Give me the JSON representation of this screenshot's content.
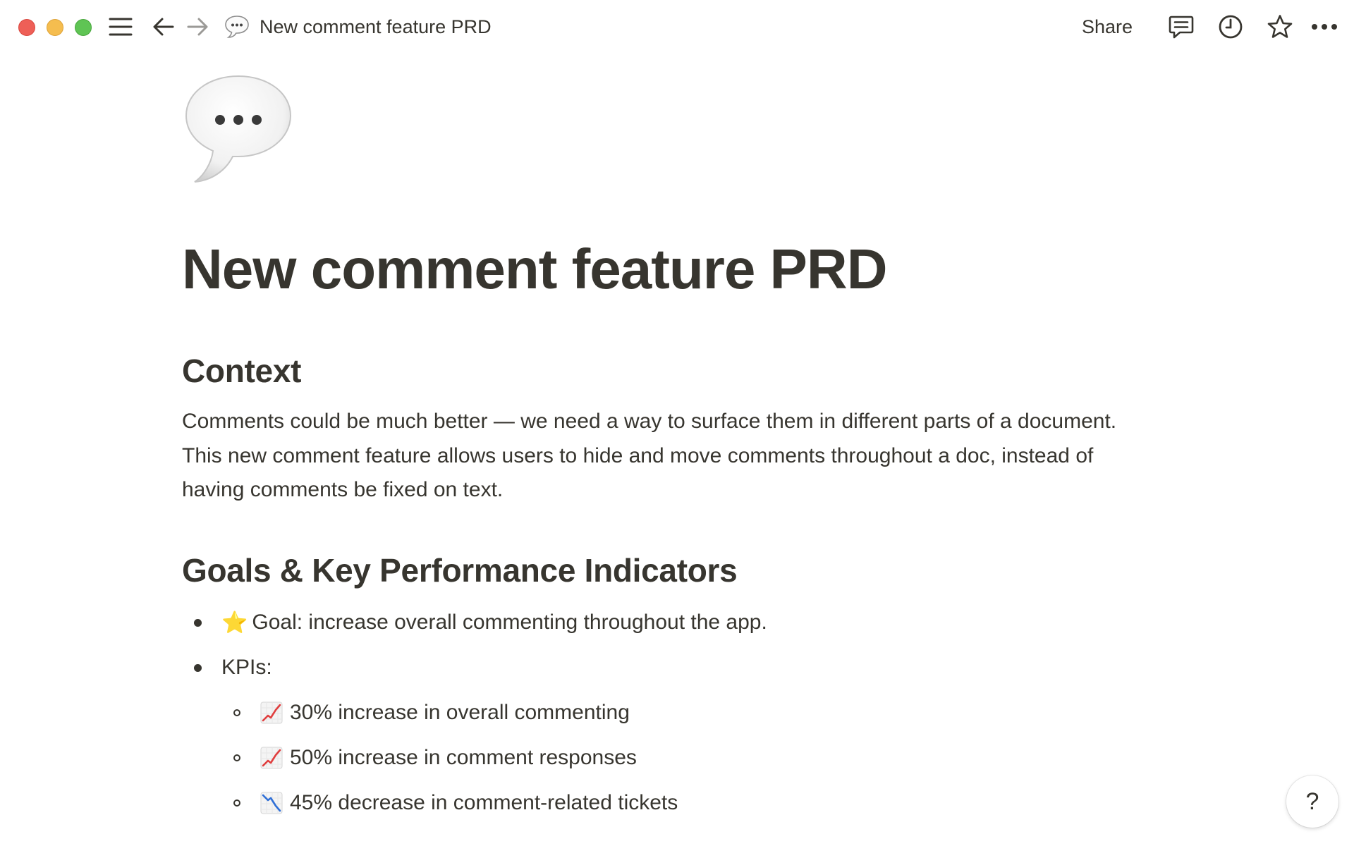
{
  "window": {
    "controls": [
      "close",
      "minimize",
      "zoom"
    ]
  },
  "topbar": {
    "icons": {
      "menu": "hamburger-icon",
      "back": "arrow-left-icon",
      "forward": "arrow-right-icon",
      "comments": "comment-icon",
      "updates": "clock-icon",
      "favorite": "star-icon",
      "more": "more-icon"
    },
    "breadcrumb_emoji": "speech-balloon-icon",
    "breadcrumb_title": "New comment feature PRD",
    "share_label": "Share"
  },
  "page": {
    "icon": "speech-balloon-icon",
    "title": "New comment feature PRD",
    "sections": [
      {
        "heading": "Context",
        "paragraph": "Comments could be much better — we need a way to surface them in different parts of a document. This new comment feature allows users to hide and move comments throughout a doc, instead of having comments be fixed on text."
      },
      {
        "heading": "Goals & Key Performance Indicators",
        "bullets": [
          {
            "emoji": "⭐",
            "text": "Goal: increase overall commenting throughout the app."
          },
          {
            "text": "KPIs:"
          }
        ],
        "sub_bullets": [
          {
            "emoji_icon": "chart-increasing-icon",
            "text": "30% increase in overall commenting"
          },
          {
            "emoji_icon": "chart-increasing-icon",
            "text": "50% increase in comment responses"
          },
          {
            "emoji_icon": "chart-decreasing-icon",
            "text": "45% decrease in comment-related tickets"
          }
        ]
      }
    ]
  },
  "help": {
    "label": "?"
  },
  "colors": {
    "text": "#37352f",
    "close": "#ee5f57",
    "minimize": "#f5bd4f",
    "zoom": "#5fc454",
    "chart_up": "#e03e3e",
    "chart_down": "#2f6fd6"
  }
}
